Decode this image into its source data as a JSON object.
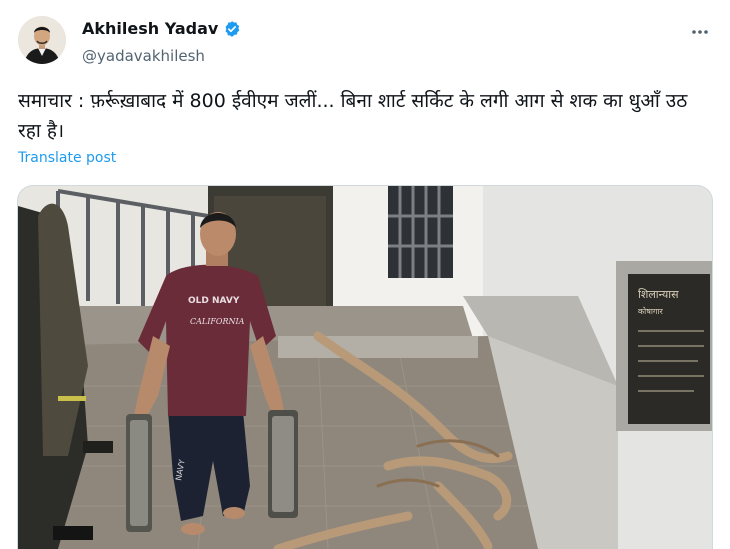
{
  "author": {
    "display_name": "Akhilesh Yadav",
    "handle": "@yadavakhilesh",
    "verified": true,
    "verified_color": "#1d9bf0"
  },
  "post": {
    "text": "समाचार : फ़र्रूख़ाबाद में 800 ईवीएम जलीं... बिना शार्ट सर्किट के लगी आग से शक का धुआँ उठ रहा है।",
    "translate_label": "Translate post"
  },
  "media": {
    "type": "photo",
    "tshirt_text": [
      "OLD NAVY",
      "CALIFORNIA"
    ],
    "plaque_text": [
      "शिलान्यास",
      "कोषागार"
    ]
  },
  "icons": {
    "more": "more-horizontal-icon",
    "verified": "verified-badge-icon"
  },
  "colors": {
    "link": "#1d9bf0",
    "text": "#0f1419",
    "secondary": "#536471"
  }
}
